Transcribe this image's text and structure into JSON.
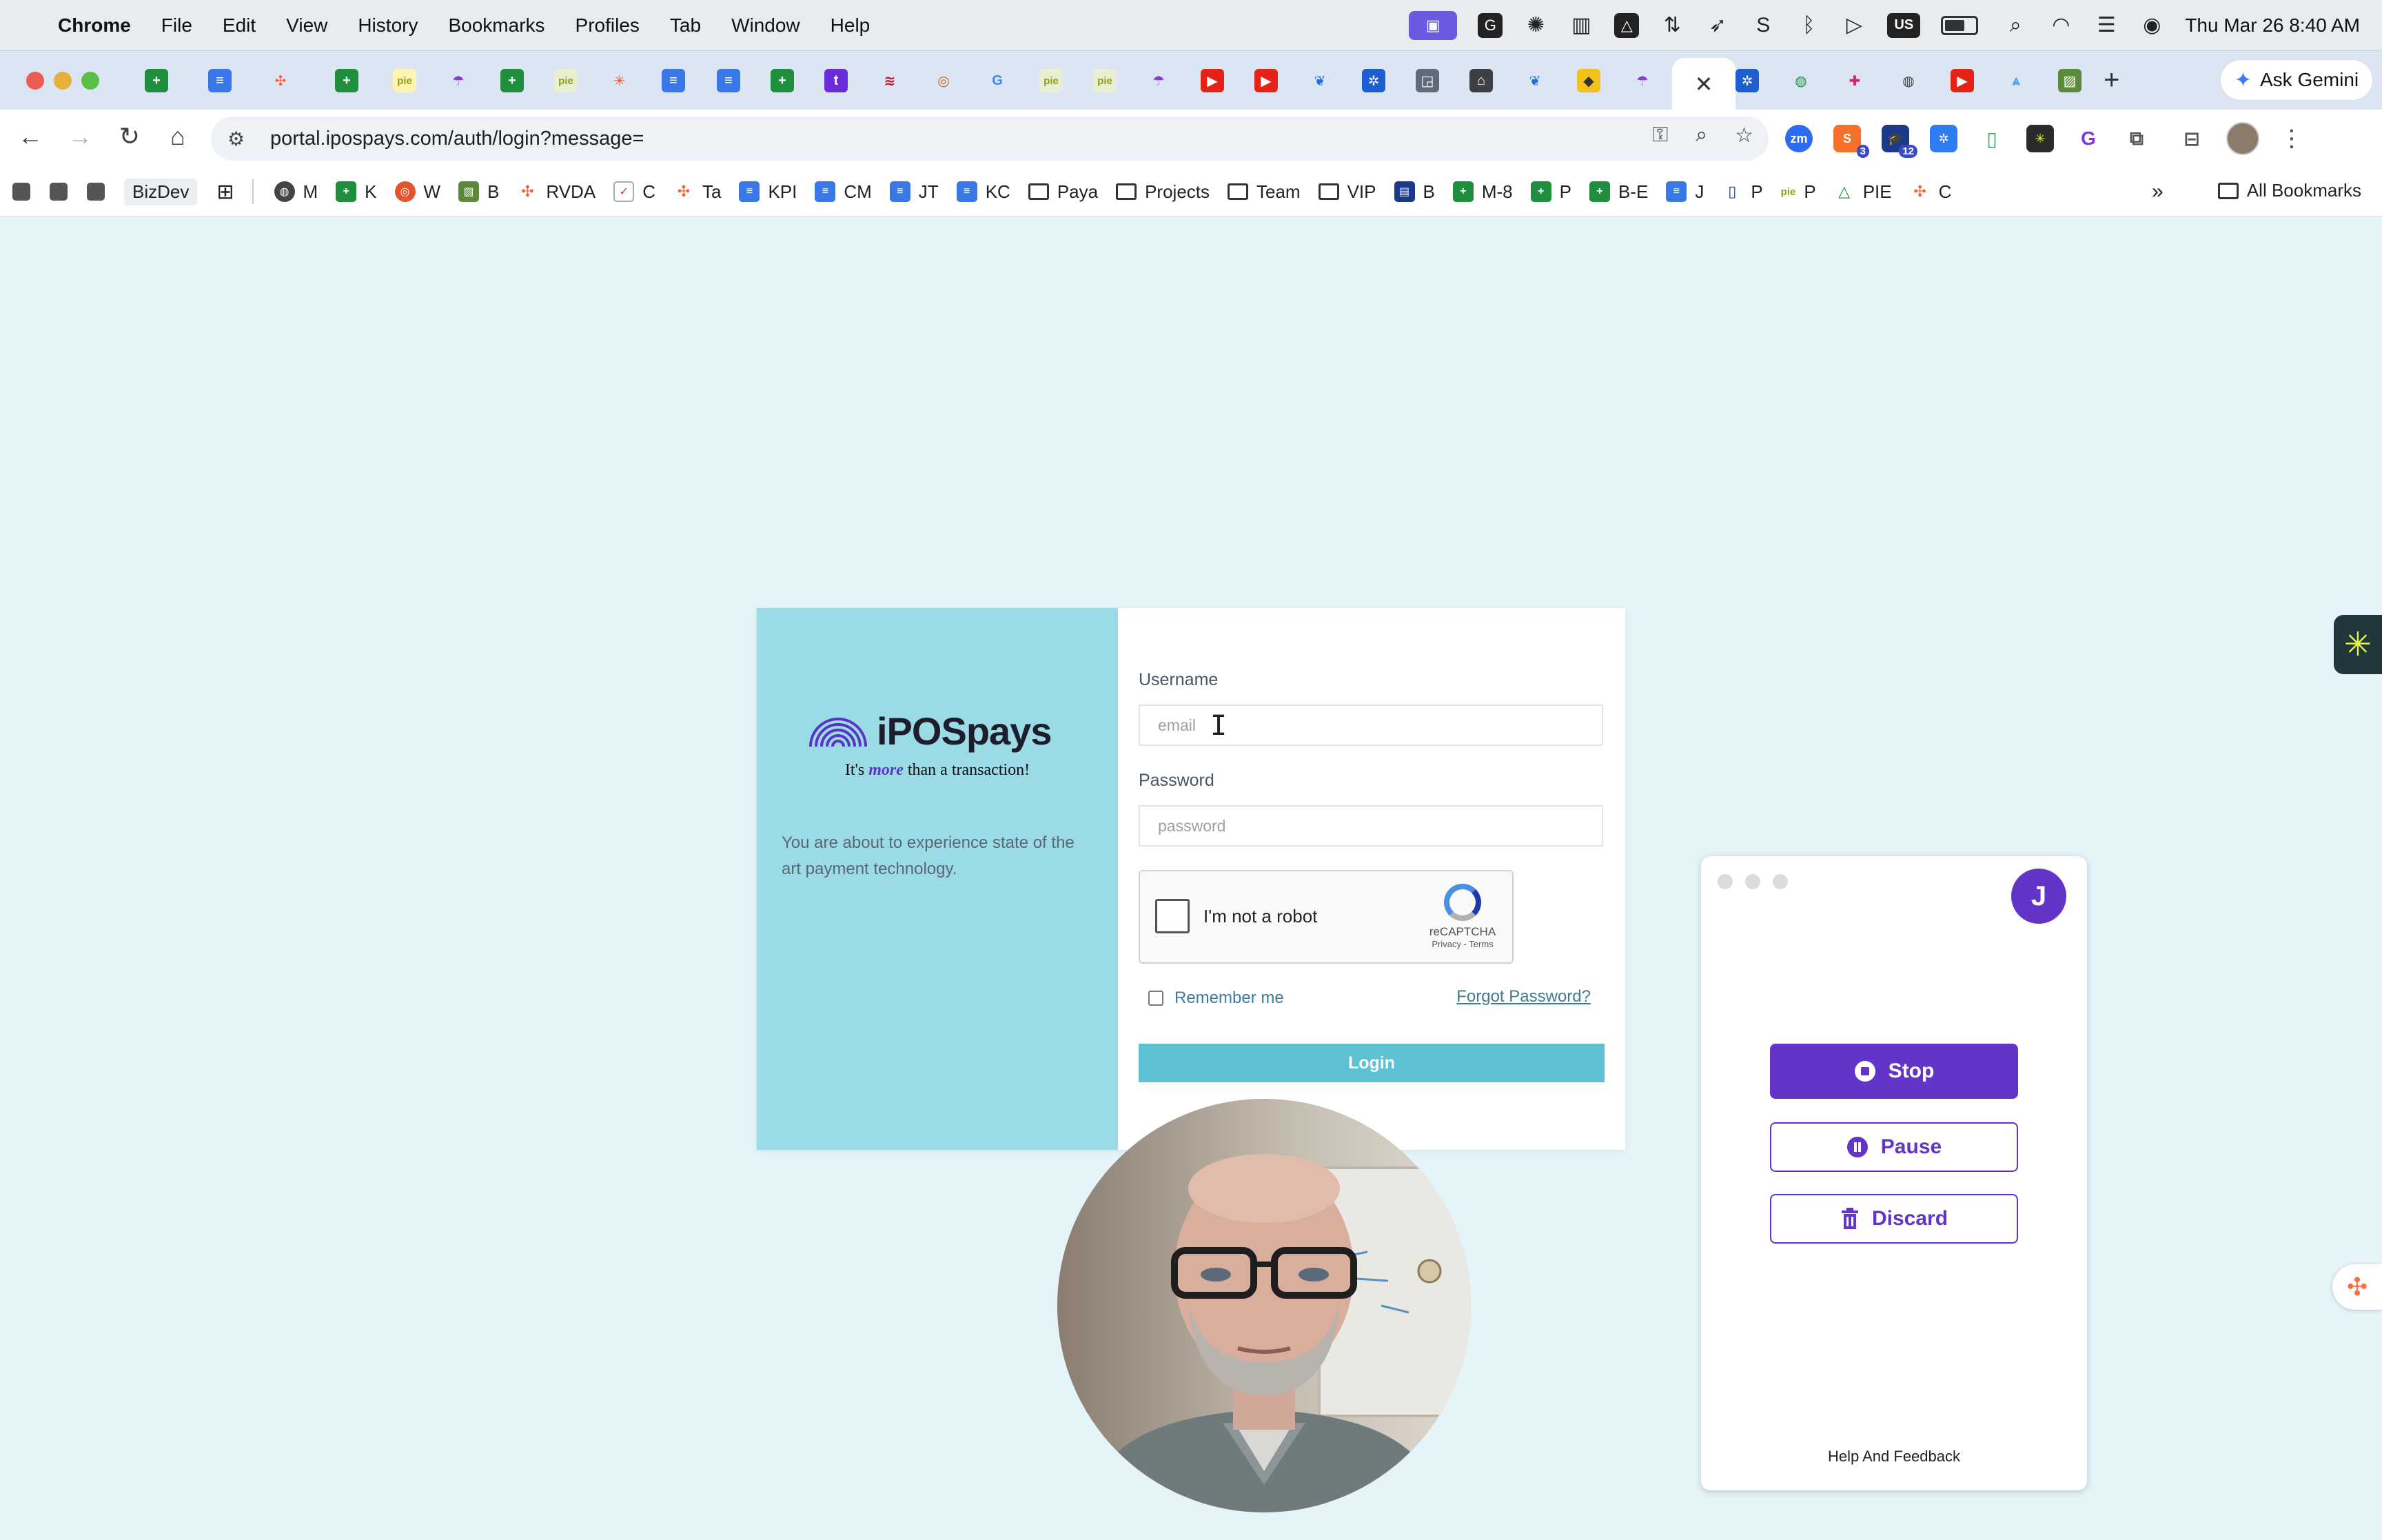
{
  "menubar": {
    "app": "Chrome",
    "items": [
      "File",
      "Edit",
      "View",
      "History",
      "Bookmarks",
      "Profiles",
      "Tab",
      "Window",
      "Help"
    ],
    "status_us": "US",
    "clock": "Thu Mar 26  8:40 AM"
  },
  "tabstrip": {
    "active_close": "✕",
    "new_tab": "+",
    "gemini_label": "Ask Gemini"
  },
  "toolbar": {
    "url": "portal.ipospays.com/auth/login?message=",
    "ext_zm": "zm",
    "ext_badge_1": "3",
    "ext_badge_2": "12"
  },
  "bookmarks": {
    "chip": "BizDev",
    "items": [
      "M",
      "W",
      "B",
      "RVDA",
      "C",
      "Ta",
      "KPI",
      "CM",
      "JT",
      "KC",
      "Paya",
      "Projects",
      "Team",
      "VIP",
      "B",
      "M-8",
      "P",
      "B-E",
      "J",
      "P",
      "P",
      "PIE",
      "C"
    ],
    "k_label": "K",
    "pie_text": "pie",
    "overflow": "»",
    "all": "All Bookmarks"
  },
  "login": {
    "brand": "iPOSpays",
    "tagline_pre": "It's ",
    "tagline_em": "more",
    "tagline_post": " than a transaction!",
    "description": "You are about to experience state of the art payment technology.",
    "username_label": "Username",
    "username_placeholder": "email",
    "password_label": "Password",
    "password_placeholder": "password",
    "captcha_label": "I'm not a robot",
    "captcha_brand": "reCAPTCHA",
    "captcha_links": "Privacy - Terms",
    "remember_label": "Remember me",
    "forgot_label": "Forgot Password?",
    "login_button": "Login"
  },
  "recorder": {
    "avatar_initial": "J",
    "stop": "Stop",
    "pause": "Pause",
    "discard": "Discard",
    "help": "Help And Feedback"
  },
  "colors": {
    "page_bg": "#e4f4f8",
    "brand_panel": "#9adbe6",
    "login_button": "#5cc2d2",
    "recorder_accent": "#6234c7"
  }
}
